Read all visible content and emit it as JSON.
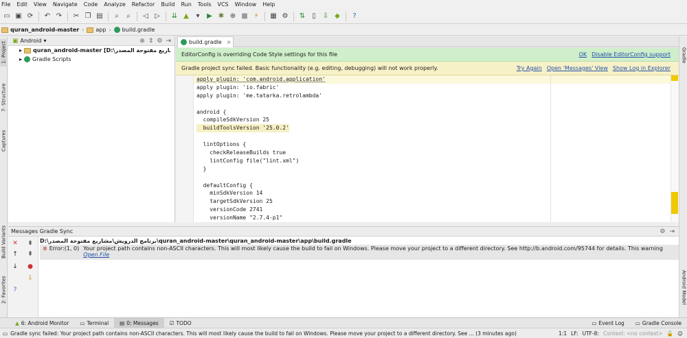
{
  "menu": [
    "File",
    "Edit",
    "View",
    "Navigate",
    "Code",
    "Analyze",
    "Refactor",
    "Build",
    "Run",
    "Tools",
    "VCS",
    "Window",
    "Help"
  ],
  "breadcrumb": [
    "quran_android-master",
    "app",
    "build.gradle"
  ],
  "project_panel": {
    "view_selector": "Android",
    "tree": [
      "quran_android-master [D:\\بررنامج الدرويش\\مشاريع مفتوحة المصدر]",
      "Gradle Scripts"
    ]
  },
  "editor": {
    "tab_label": "build.gradle",
    "banner_editorconfig": {
      "text": "EditorConfig is overriding Code Style settings for this file",
      "links": [
        "OK",
        "Disable EditorConfig support"
      ]
    },
    "banner_sync": {
      "text": "Gradle project sync failed. Basic functionality (e.g. editing, debugging) will not work properly.",
      "links": [
        "Try Again",
        "Open 'Messages' View",
        "Show Log in Explorer"
      ]
    },
    "code_lines": [
      "apply plugin: 'com.android.application'",
      "apply plugin: 'io.fabric'",
      "apply plugin: 'me.tatarka.retrolambda'",
      "",
      "android {",
      "  compileSdkVersion 25",
      "  buildToolsVersion '25.0.2'",
      "",
      "  lintOptions {",
      "    checkReleaseBuilds true",
      "    lintConfig file(\"lint.xml\")",
      "  }",
      "",
      "  defaultConfig {",
      "    minSdkVersion 14",
      "    targetSdkVersion 25",
      "    versionCode 2741",
      "    versionName \"2.7.4-p1\""
    ]
  },
  "messages": {
    "title": "Messages Gradle Sync",
    "path": "D:\\برنامج الدرويش\\مشاريع مفتوحة المصدر\\quran_android-master\\quran_android-master\\app\\build.gradle",
    "error_location": "Error:(1, 0)",
    "error_text": "Your project path contains non-ASCII characters. This will most likely cause the build to fail on Windows. Please move your project to a different directory. See http://b.android.com/95744 for details. This warning",
    "error_link": "Open File"
  },
  "bottom_tabs": [
    "6: Android Monitor",
    "Terminal",
    "0: Messages",
    "TODO"
  ],
  "bottom_right_tabs": [
    "Event Log",
    "Gradle Console"
  ],
  "left_tool_tabs": [
    "1: Project",
    "7: Structure",
    "Captures",
    "Build Variants",
    "2: Favorites"
  ],
  "right_tool_tabs": [
    "Gradle",
    "Android Model"
  ],
  "status": {
    "message": "Gradle sync failed: Your project path contains non-ASCII characters. This will most likely cause the build to fail on Windows. Please move your project to a different directory. See ... (3 minutes ago)",
    "position": "1:1",
    "line_sep": "LF:",
    "encoding": "UTF-8:",
    "context": "Context: <no context>"
  }
}
